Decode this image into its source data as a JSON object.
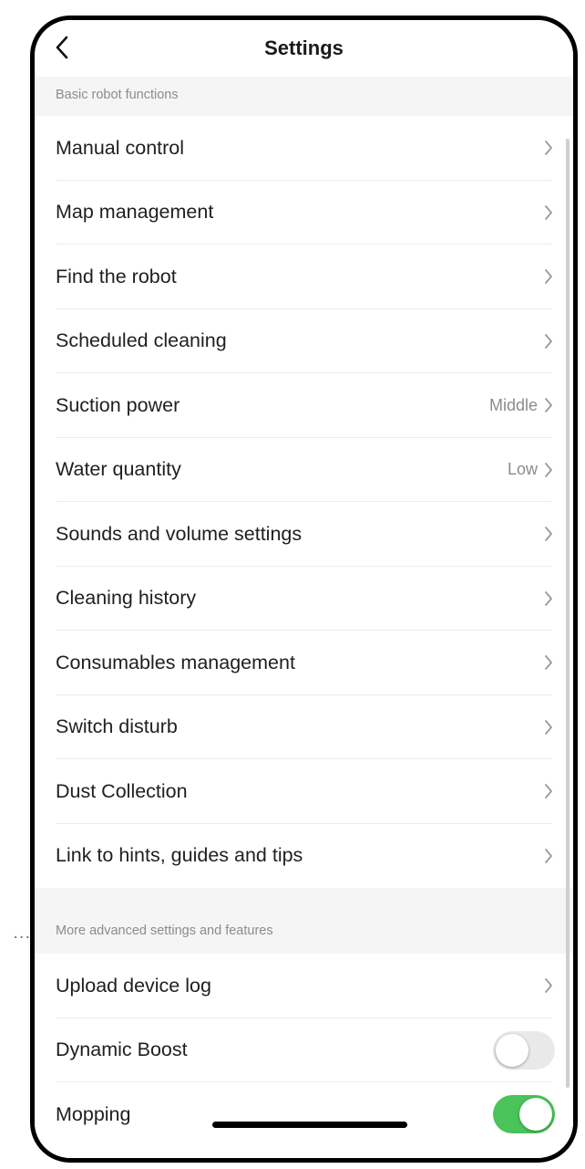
{
  "outside_ellipsis": "...",
  "header": {
    "title": "Settings"
  },
  "sections": [
    {
      "title": "Basic robot functions",
      "items": [
        {
          "label": "Manual control",
          "value": ""
        },
        {
          "label": "Map management",
          "value": ""
        },
        {
          "label": "Find the robot",
          "value": ""
        },
        {
          "label": "Scheduled cleaning",
          "value": ""
        },
        {
          "label": "Suction power",
          "value": "Middle"
        },
        {
          "label": "Water quantity",
          "value": "Low"
        },
        {
          "label": "Sounds and volume settings",
          "value": ""
        },
        {
          "label": "Cleaning history",
          "value": ""
        },
        {
          "label": "Consumables management",
          "value": ""
        },
        {
          "label": "Switch disturb",
          "value": ""
        },
        {
          "label": "Dust Collection",
          "value": ""
        },
        {
          "label": "Link to hints, guides and tips",
          "value": ""
        }
      ]
    },
    {
      "title": "More advanced settings and features",
      "items": [
        {
          "label": "Upload device log"
        },
        {
          "label": "Dynamic Boost",
          "toggle": false
        },
        {
          "label": "Mopping",
          "toggle": true
        }
      ]
    }
  ],
  "icons": {
    "back": "chevron-left-icon",
    "row_arrow": "chevron-right-icon"
  },
  "colors": {
    "toggle_on": "#49c35a",
    "toggle_off": "#e9e9ea",
    "section_bg": "#f5f5f5"
  }
}
